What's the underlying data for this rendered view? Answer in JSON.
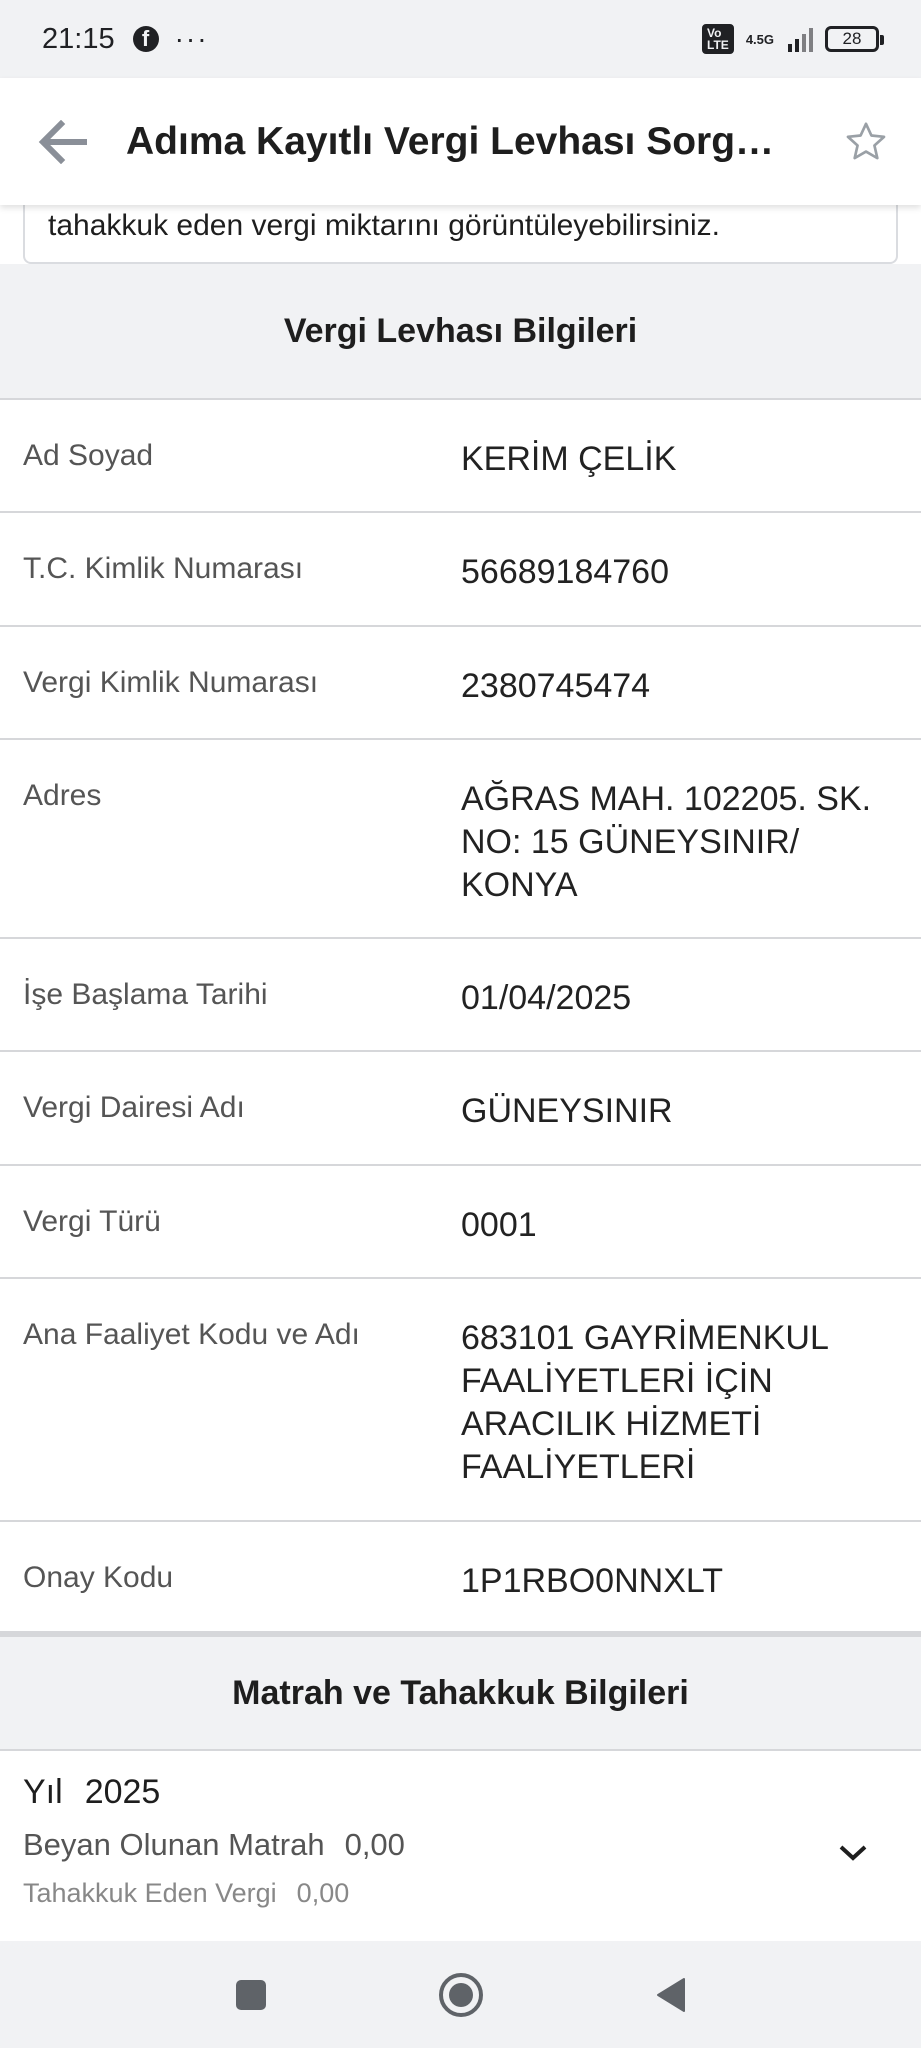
{
  "status_bar": {
    "time": "21:15",
    "dots": "···",
    "volte": "VoLTE",
    "network": "4.5G",
    "battery": "28"
  },
  "header": {
    "title": "Adıma Kayıtlı Vergi Levhası Sorgulama",
    "back_icon": "arrow-left-icon",
    "star_icon": "star-outline-icon"
  },
  "intro": {
    "text": "tahakkuk eden vergi miktarını görüntüleyebilirsiniz."
  },
  "levha": {
    "heading": "Vergi Levhası Bilgileri",
    "rows": [
      {
        "label": "Ad Soyad",
        "value": "KERİM ÇELİK"
      },
      {
        "label": "T.C. Kimlik Numarası",
        "value": "56689184760"
      },
      {
        "label": "Vergi Kimlik Numarası",
        "value": "2380745474"
      },
      {
        "label": "Adres",
        "value": "AĞRAS MAH. 102205. SK. NO: 15 GÜNEYSINIR/ KONYA"
      },
      {
        "label": "İşe Başlama Tarihi",
        "value": "01/04/2025"
      },
      {
        "label": "Vergi Dairesi Adı",
        "value": "GÜNEYSINIR"
      },
      {
        "label": "Vergi Türü",
        "value": "0001"
      },
      {
        "label": "Ana Faaliyet Kodu ve Adı",
        "value": "683101 GAYRİMENKUL FAALİYETLERİ İÇİN ARACILIK HİZMETİ FAALİYETLERİ"
      },
      {
        "label": "Onay Kodu",
        "value": "1P1RBO0NNXLT"
      }
    ]
  },
  "matrah": {
    "heading": "Matrah ve Tahakkuk Bilgileri",
    "year_label": "Yıl",
    "year_value": "2025",
    "beyan_label": "Beyan Olunan Matrah",
    "beyan_value": "0,00",
    "tahakkuk_label": "Tahakkuk Eden Vergi",
    "tahakkuk_value": "0,00"
  },
  "colors": {
    "accent_gray": "#8a8f98",
    "background_gray": "#f1f2f4"
  }
}
